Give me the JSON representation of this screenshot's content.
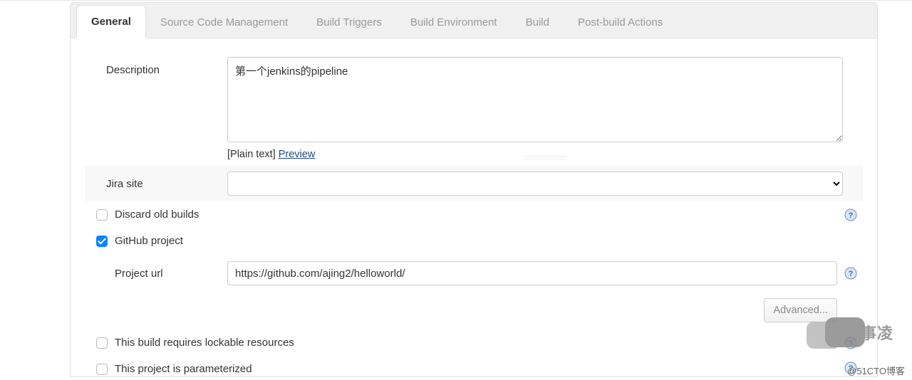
{
  "tabs": {
    "general": "General",
    "scm": "Source Code Management",
    "triggers": "Build Triggers",
    "env": "Build Environment",
    "build": "Build",
    "postbuild": "Post-build Actions"
  },
  "labels": {
    "description": "Description",
    "plain_text_prefix": "[Plain text] ",
    "preview": "Preview",
    "jira_site": "Jira site",
    "discard_old_builds": "Discard old builds",
    "github_project": "GitHub project",
    "project_url": "Project url",
    "advanced": "Advanced...",
    "lockable": "This build requires lockable resources",
    "parameterized": "This project is parameterized"
  },
  "values": {
    "description": "第一个jenkins的pipeline",
    "jira_site": "",
    "project_url": "https://github.com/ajing2/helloworld/",
    "discard_checked": false,
    "github_checked": true,
    "lockable_checked": false,
    "parameterized_checked": false
  },
  "watermark": {
    "chat_text": "故事凌",
    "blog_text": "@51CTO博客"
  }
}
